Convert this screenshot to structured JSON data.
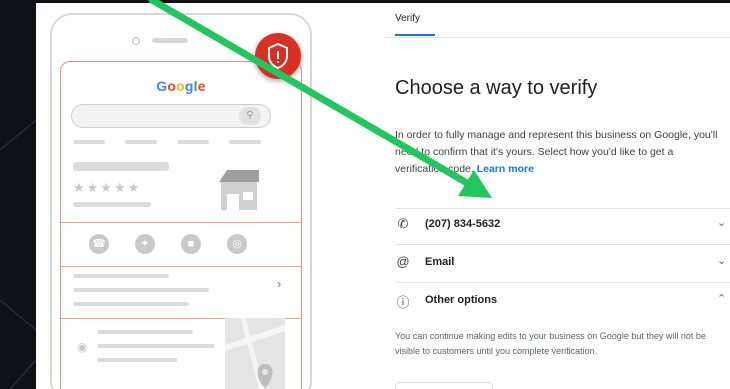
{
  "colors": {
    "accent": "#1a73e8",
    "arrow": "#22c55e",
    "badge": "#d93025",
    "phone_border": "#f08a84"
  },
  "illustration": {
    "logo_text": "Google",
    "icons": [
      "shield-alert-icon",
      "phone-icon",
      "directions-icon",
      "bookmark-icon",
      "website-icon",
      "storefront-icon",
      "location-pin-icon",
      "map-icon",
      "chevron-right-icon"
    ]
  },
  "header": {
    "tab_label": "Verify"
  },
  "main": {
    "title": "Choose a way to verify",
    "intro": "In order to fully manage and represent this business on Google, you'll need to confirm that it's yours. Select how you'd like to get a verification code.",
    "learn_more": "Learn more"
  },
  "options": [
    {
      "icon": "phone-icon",
      "label": "(207) 834-5632",
      "state": "collapsed"
    },
    {
      "icon": "at-sign-icon",
      "label": "Email",
      "state": "collapsed"
    },
    {
      "icon": "help-circle-icon",
      "label": "Other options",
      "state": "expanded"
    }
  ],
  "footnote": "You can continue making edits to your business on Google but they will not be visible to customers until you complete verification."
}
